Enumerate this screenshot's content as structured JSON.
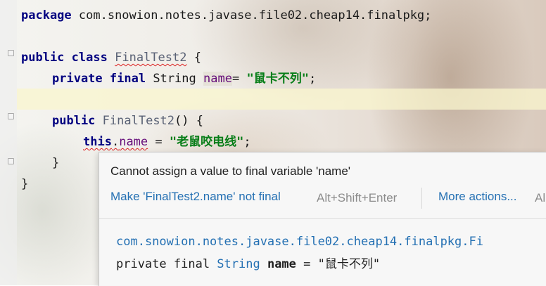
{
  "editor": {
    "line1": {
      "kw": "package",
      "rest": " com.snowion.notes.javase.file02.cheap14.finalpkg;"
    },
    "line3": {
      "kw1": "public",
      "kw2": "class",
      "class_name": "FinalTest2",
      "brace": " {"
    },
    "line4": {
      "kw1": "private",
      "kw2": "final",
      "type": "String",
      "field": "name",
      "eq": "= ",
      "str": "\"鼠卡不列\"",
      "semi": ";"
    },
    "line6": {
      "kw": "public",
      "ctor": "FinalTest2",
      "rest": "() {"
    },
    "line7": {
      "kw": "this",
      "dot": ".",
      "field": "name",
      "eq": " = ",
      "str": "\"老鼠咬电线\"",
      "semi": ";"
    },
    "line8": {
      "brace": "}"
    },
    "line9": {
      "brace": "}"
    }
  },
  "popup": {
    "message": "Cannot assign a value to final variable 'name'",
    "action_label": "Make 'FinalTest2.name' not final",
    "action_shortcut": "Alt+Shift+Enter",
    "more_label": "More actions...",
    "more_shortcut": "Al",
    "doc_package": "com.snowion.notes.javase.file02.cheap14.finalpkg.Fi",
    "doc_decl": {
      "mods": "private final ",
      "type": "String",
      "name": " name",
      "value": " = \"鼠卡不列\""
    }
  },
  "colors": {
    "keyword": "#000080",
    "string": "#067d17",
    "field": "#660e7a",
    "link": "#2470b3",
    "line_highlight": "#faf6cd"
  }
}
